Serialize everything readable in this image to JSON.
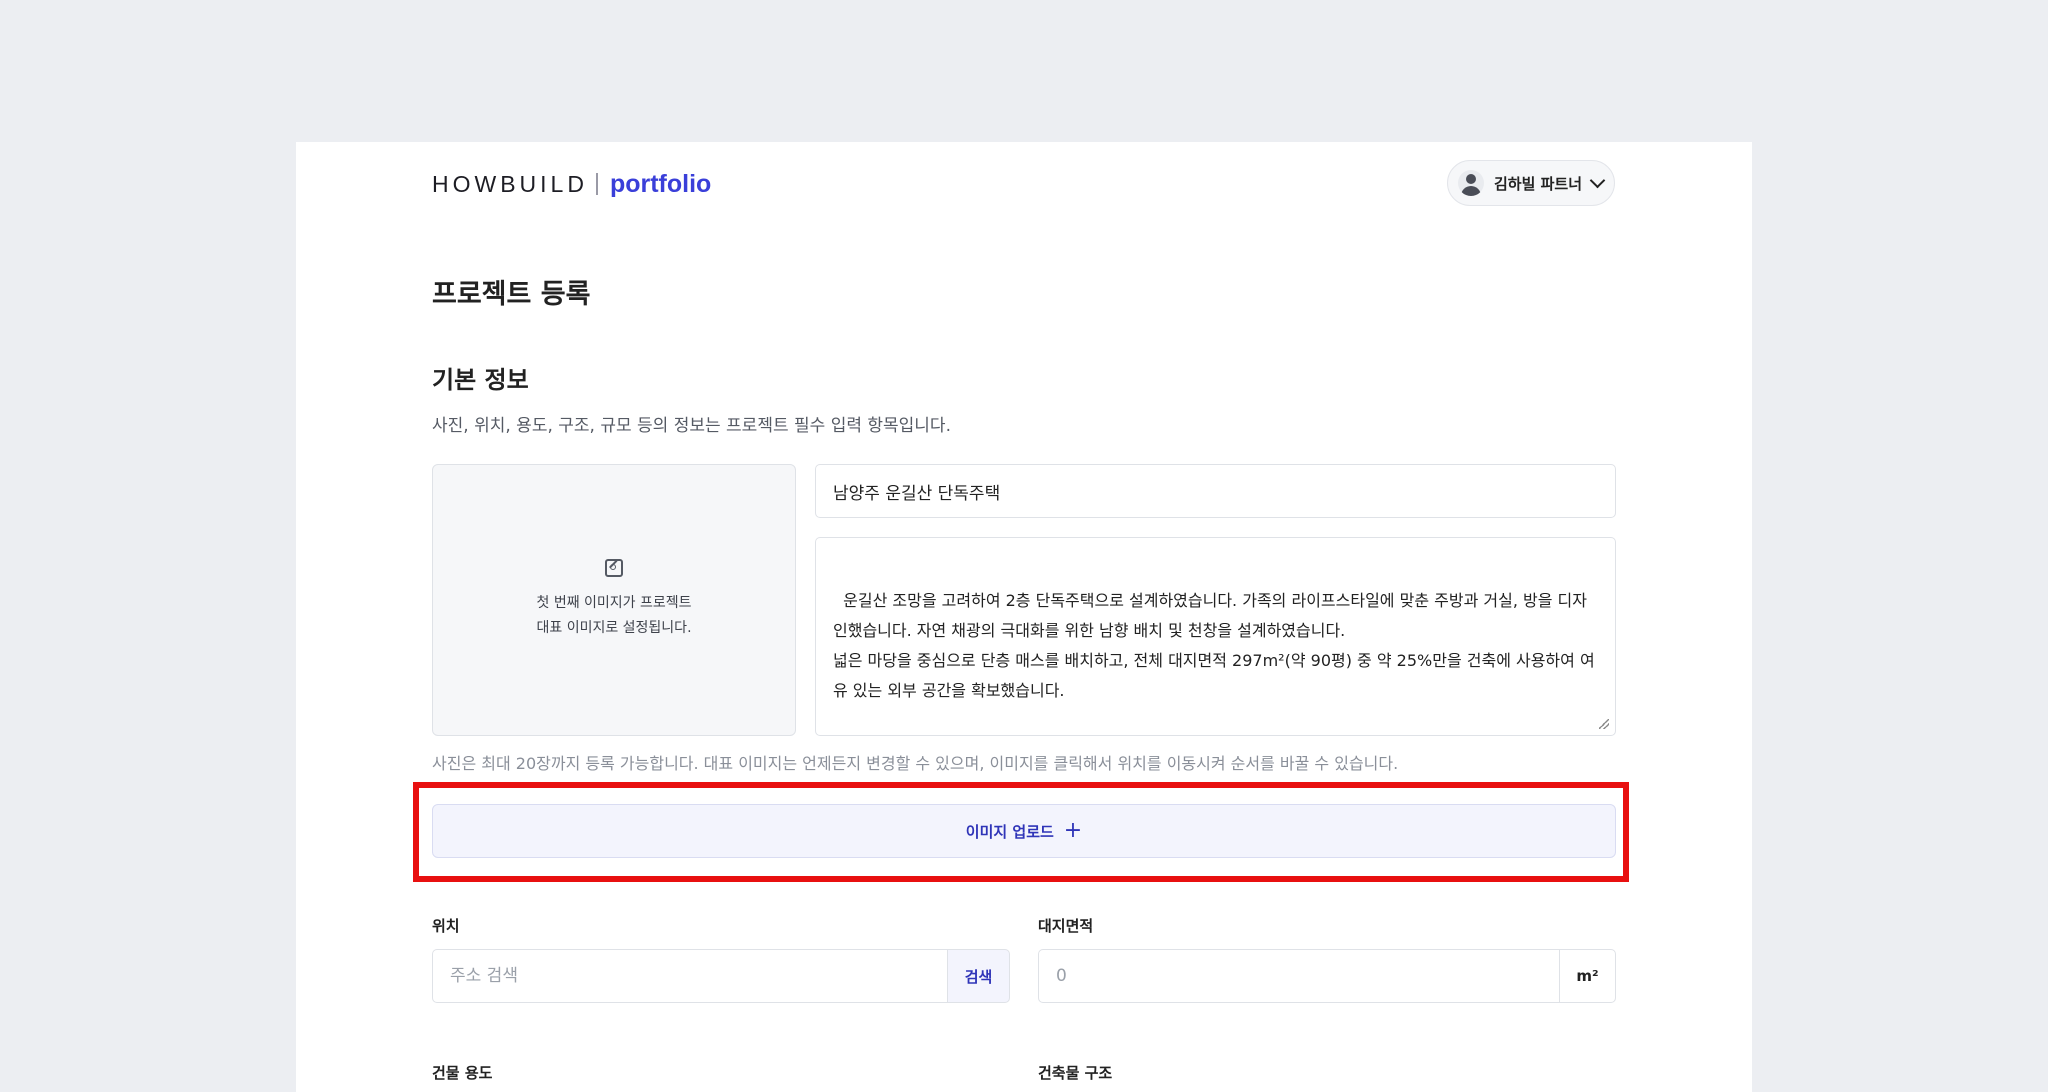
{
  "header": {
    "logo_main": "HOWBUILD",
    "logo_sub": "portfolio",
    "user_name": "김하빌 파트너"
  },
  "page": {
    "title": "프로젝트 등록"
  },
  "basic_info": {
    "title": "기본 정보",
    "description": "사진, 위치, 용도, 구조, 규모 등의 정보는 프로젝트 필수 입력 항목입니다.",
    "image_hint": "첫 번째 이미지가 프로젝트\n대표 이미지로 설정됩니다.",
    "project_name": "남양주 운길산 단독주택",
    "project_description": "운길산 조망을 고려하여 2층 단독주택으로 설계하였습니다. 가족의 라이프스타일에 맞춘 주방과 거실, 방을 디자인했습니다. 자연 채광의 극대화를 위한 남향 배치 및 천창을 설계하였습니다.\n넓은 마당을 중심으로 단층 매스를 배치하고, 전체 대지면적 297m²(약 90평) 중 약 25%만을 건축에 사용하여 여유 있는 외부 공간을 확보했습니다.",
    "photo_note": "사진은 최대 20장까지 등록 가능합니다. 대표 이미지는 언제든지 변경할 수 있으며, 이미지를 클릭해서 위치를 이동시켜 순서를 바꿀 수 있습니다.",
    "upload_label": "이미지 업로드",
    "upload_icon": "+"
  },
  "fields": {
    "location_label": "위치",
    "location_placeholder": "주소 검색",
    "search_label": "검색",
    "land_area_label": "대지면적",
    "land_area_placeholder": "0",
    "land_area_unit": "m²",
    "building_use_label": "건물 용도",
    "building_structure_label": "건축물 구조"
  },
  "colors": {
    "accent": "#3a3fd9",
    "highlight": "#e81010",
    "background": "#eceef2"
  }
}
